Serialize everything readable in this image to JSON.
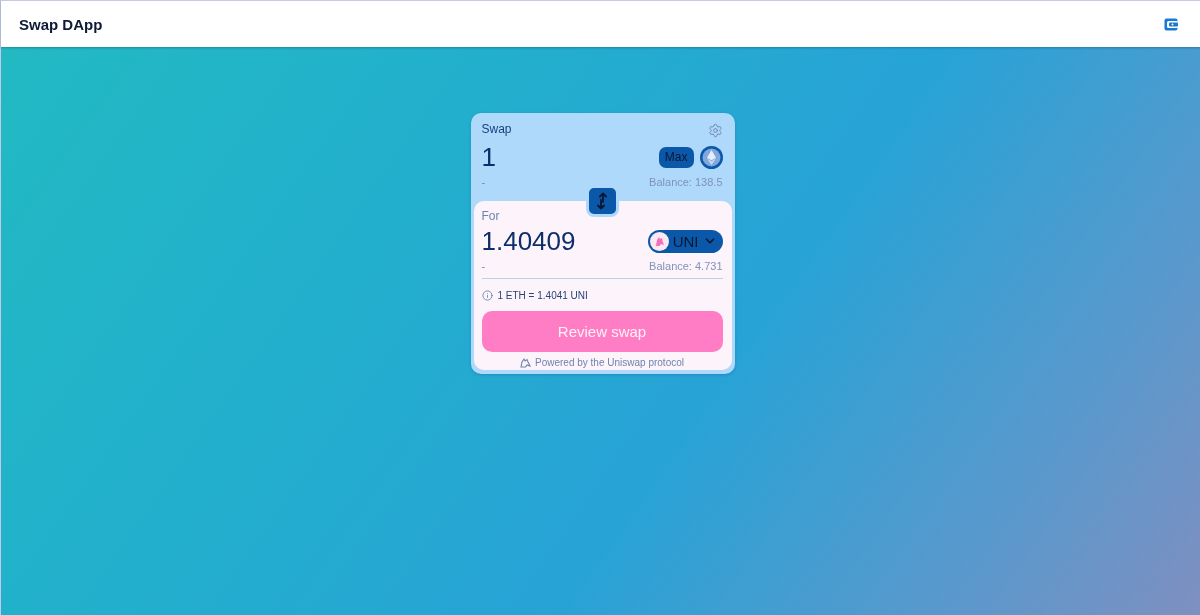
{
  "header": {
    "title": "Swap DApp"
  },
  "swap": {
    "title": "Swap",
    "input": {
      "amount": "1",
      "usd": "-",
      "max_label": "Max",
      "balance": "Balance: 138.5"
    },
    "output": {
      "label": "For",
      "amount": "1.40409",
      "usd": "-",
      "token": "UNI",
      "balance": "Balance: 4.731"
    },
    "rate": "1 ETH = 1.4041 UNI",
    "review_button": "Review swap",
    "footer": "Powered by the Uniswap protocol"
  }
}
